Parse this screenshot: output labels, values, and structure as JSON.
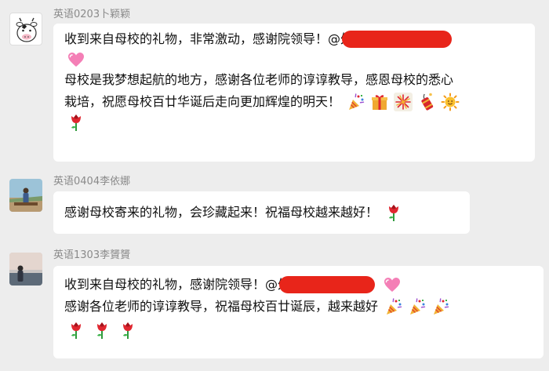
{
  "messages": [
    {
      "sender": "英语0203卜颖颖",
      "avatar": "cow-cartoon-avatar",
      "lines": [
        {
          "parts": [
            "收到来自母校的礼物，非常激动，感谢院领导！@外语"
          ]
        },
        {
          "parts": []
        },
        {
          "parts": [
            "母校是我梦想起航的地方，感谢各位老师的谆谆教导，感恩母校的悉心"
          ]
        },
        {
          "parts": [
            "栽培，祝愿母校百廿华诞后走向更加辉煌的明天！"
          ]
        }
      ],
      "emojis": [
        "pink-heart-icon",
        "party-popper-icon",
        "gift-icon",
        "fireworks-icon",
        "firecracker-icon",
        "sun-icon",
        "rose-icon"
      ]
    },
    {
      "sender": "英语0404李依娜",
      "avatar": "outdoor-photo-avatar",
      "lines": [
        {
          "parts": [
            "感谢母校寄来的礼物，会珍藏起来！祝福母校越来越好！"
          ]
        }
      ],
      "emojis": [
        "rose-icon"
      ]
    },
    {
      "sender": "英语1303李贇贇",
      "avatar": "sky-photo-avatar",
      "lines": [
        {
          "parts": [
            "收到来自母校的礼物，感谢院领导！@外语"
          ]
        },
        {
          "parts": [
            "感谢各位老师的谆谆教导，祝福母校百廿诞辰，越来越好"
          ]
        }
      ],
      "emojis": [
        "pink-heart-icon",
        "party-popper-icon",
        "party-popper-icon",
        "party-popper-icon",
        "rose-icon",
        "rose-icon",
        "rose-icon"
      ]
    }
  ]
}
